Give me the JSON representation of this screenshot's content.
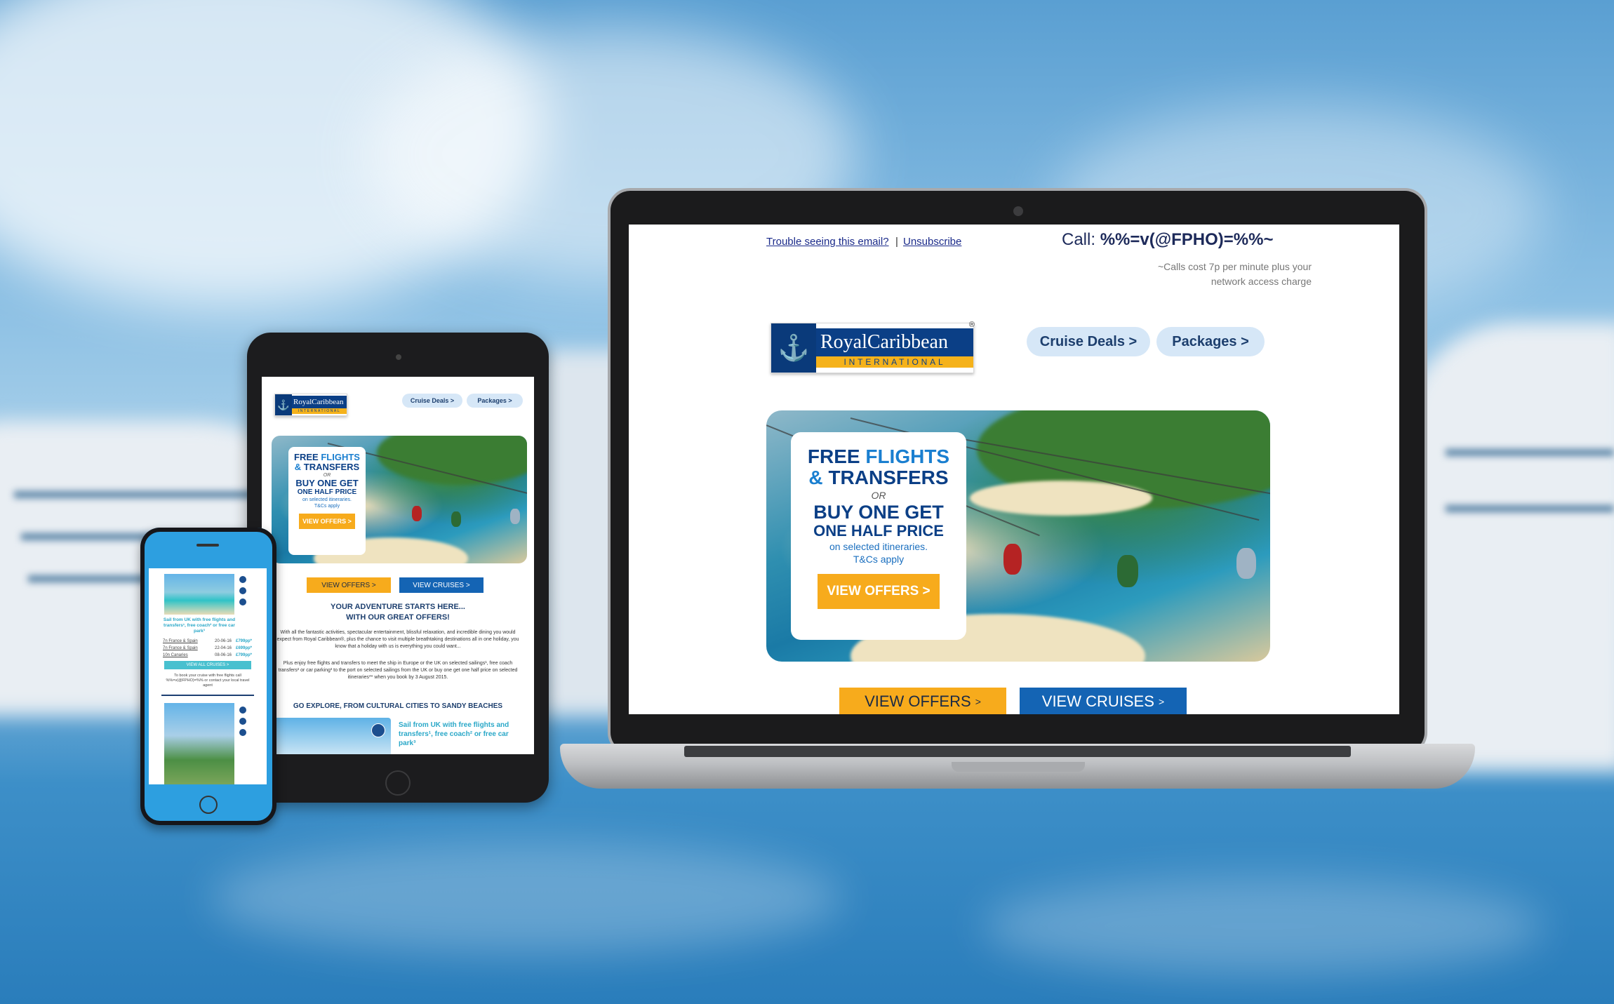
{
  "laptop": {
    "trouble_link": "Trouble seeing this email?",
    "separator": "|",
    "unsubscribe_link": "Unsubscribe",
    "call_label": "Call:",
    "call_value": "%%=v(@FPHO)=%%~",
    "call_note": "~Calls cost 7p per minute plus your network access charge",
    "logo_brand": "RoyalCaribbean",
    "logo_intl": "INTERNATIONAL",
    "logo_reg": "®",
    "nav": [
      "Cruise Deals >",
      "Packages >"
    ],
    "promo": {
      "free": "FREE",
      "flights": "FLIGHTS",
      "amp": "&",
      "transfers": "TRANSFERS",
      "or": "OR",
      "bogo": "BUY ONE GET",
      "half": "ONE HALF PRICE",
      "selected": "on selected itineraries.",
      "tcs": "T&Cs apply",
      "cta": "VIEW OFFERS >"
    },
    "view_offers": "VIEW OFFERS",
    "view_cruises": "VIEW CRUISES",
    "chevron": ">"
  },
  "tablet": {
    "nav": [
      "Cruise Deals >",
      "Packages >"
    ],
    "view_offers": "VIEW OFFERS >",
    "view_cruises": "VIEW CRUISES >",
    "headline_1": "YOUR ADVENTURE STARTS HERE...",
    "headline_2": "WITH OUR GREAT OFFERS!",
    "body_1": "With all the fantastic activities, spectacular entertainment, blissful relaxation, and incredible dining you would expect from Royal Caribbean®, plus the chance to visit multiple breathtaking destinations all in one holiday, you know that a holiday with us is everything you could want...",
    "body_2": "Plus enjoy free flights and transfers to meet the ship in Europe or the UK on selected sailings¹, free coach transfers² or car parking³ to the port on selected sailings from the UK or buy one get one half price on selected itineraries** when you book by 3 August 2015.",
    "section_head": "GO EXPLORE, FROM CULTURAL CITIES TO SANDY BEACHES",
    "card_title": "Sail from UK with free flights and transfers¹, free coach² or free car park³"
  },
  "phone": {
    "card_title": "Sail from UK with free flights and transfers¹, free coach² or free car park³",
    "rows": [
      {
        "name": "7n France & Spain",
        "date": "20-06-16",
        "price": "£799pp*"
      },
      {
        "name": "7n France & Spain",
        "date": "22-04-16",
        "price": "£699pp*"
      },
      {
        "name": "10n Canaries",
        "date": "08-06-16",
        "price": "£799pp*"
      }
    ],
    "view_all": "VIEW ALL CRUISES >",
    "booking_note": "To book your cruise with free flights call %%=v(@FPHO)=%% or contact your local travel agent"
  }
}
